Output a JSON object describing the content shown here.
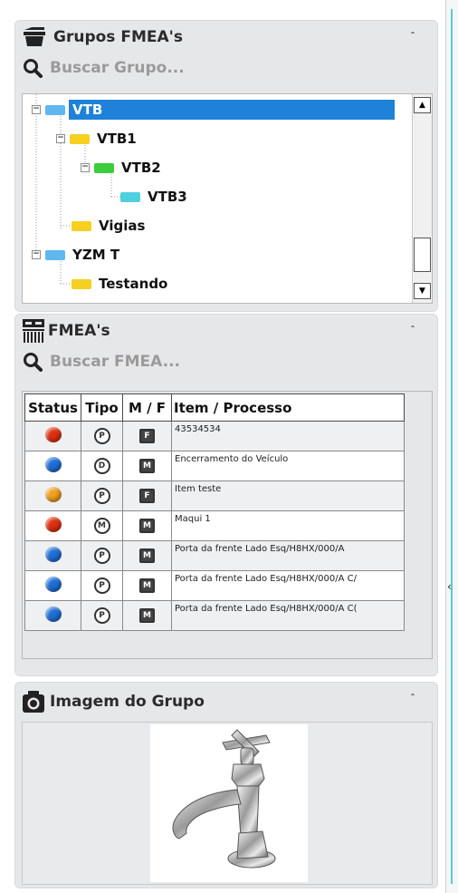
{
  "groups_panel": {
    "title": "Grupos FMEA's",
    "search_placeholder": "Buscar Grupo...",
    "tree": [
      {
        "label": "VTB",
        "level": 0,
        "color": "#5fb7f0",
        "expanded": true,
        "selected": true
      },
      {
        "label": "VTB1",
        "level": 1,
        "color": "#f5d020",
        "expanded": true,
        "selected": false
      },
      {
        "label": "VTB2",
        "level": 2,
        "color": "#3dcc3d",
        "expanded": true,
        "selected": false
      },
      {
        "label": "VTB3",
        "level": 3,
        "color": "#4fd0dd",
        "expanded": false,
        "selected": false
      },
      {
        "label": "Vigias",
        "level": 1,
        "color": "#f5d020",
        "expanded": false,
        "selected": false
      },
      {
        "label": "YZM T",
        "level": 0,
        "color": "#5fb7f0",
        "expanded": true,
        "selected": false
      },
      {
        "label": "Testando",
        "level": 1,
        "color": "#f5d020",
        "expanded": false,
        "selected": false
      }
    ]
  },
  "fmea_panel": {
    "title": "FMEA's",
    "search_placeholder": "Buscar FMEA...",
    "columns": [
      "Status",
      "Tipo",
      "M / F",
      "Item / Processo"
    ],
    "rows": [
      {
        "status_color": "#e03010",
        "tipo": "P",
        "mf": "F",
        "item": "43534534"
      },
      {
        "status_color": "#1f6fd8",
        "tipo": "D",
        "mf": "M",
        "item": "Encerramento do Veículo"
      },
      {
        "status_color": "#f0a020",
        "tipo": "P",
        "mf": "F",
        "item": "Item teste"
      },
      {
        "status_color": "#e03010",
        "tipo": "M",
        "mf": "M",
        "item": "Maqui 1"
      },
      {
        "status_color": "#1f6fd8",
        "tipo": "P",
        "mf": "M",
        "item": "Porta da frente Lado Esq/H8HX/000/A"
      },
      {
        "status_color": "#1f6fd8",
        "tipo": "P",
        "mf": "M",
        "item": "Porta da frente Lado Esq/H8HX/000/A C/"
      },
      {
        "status_color": "#1f6fd8",
        "tipo": "P",
        "mf": "M",
        "item": "Porta da frente Lado Esq/H8HX/000/A C("
      }
    ]
  },
  "image_panel": {
    "title": "Imagem do Grupo",
    "image_icon": "faucet-image"
  },
  "icons": {
    "groups": "basket-icon",
    "search": "magnifier-icon",
    "fmea": "barcode-icon",
    "image": "camera-icon",
    "collapse": "double-chevron-up-icon"
  },
  "colors": {
    "selected_bg": "#1f82d8",
    "panel_bg": "#e6e7e9"
  }
}
